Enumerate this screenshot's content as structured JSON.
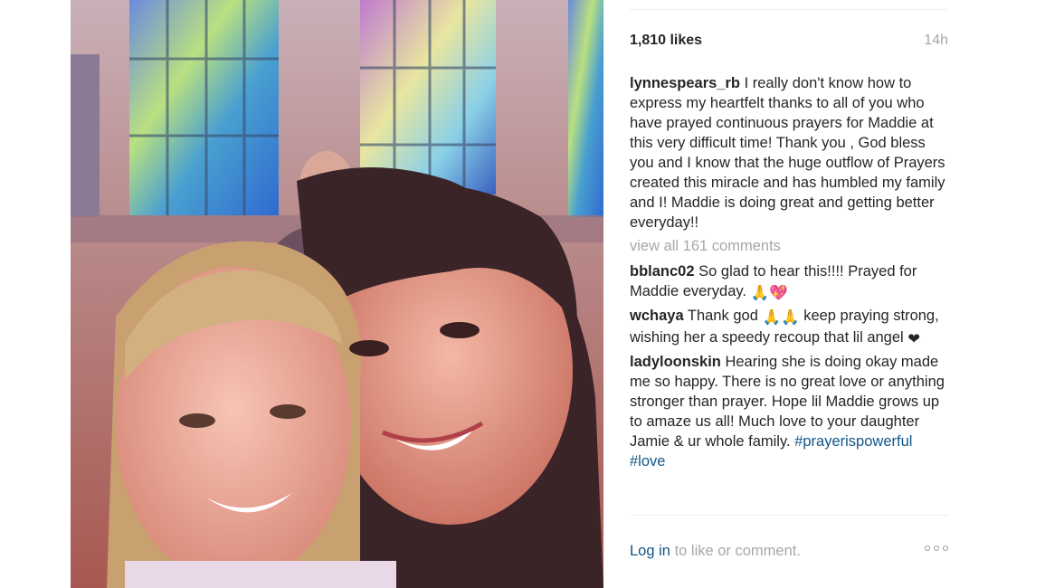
{
  "post": {
    "likes": "1,810 likes",
    "time": "14h",
    "caption": {
      "user": "lynnespears_rb",
      "text": "I really don't know how to express my heartfelt thanks to all of you who have prayed continuous prayers for Maddie at this very difficult time! Thank you , God bless you and I know that the huge outflow of Prayers created this miracle and has humbled my family and I! Maddie is doing great and getting better everyday!!"
    },
    "view_all": "view all 161 comments",
    "comments": [
      {
        "user": "bblanc02",
        "text": "So glad to hear this!!!! Prayed for Maddie everyday.",
        "emoji": "🙏💖"
      },
      {
        "user": "wchaya",
        "text_before": "Thank god",
        "emoji": "🙏🙏",
        "text_after": "keep praying strong, wishing her a speedy recoup that lil angel",
        "emoji2": "❤"
      },
      {
        "user": "ladyloonskin",
        "text": "Hearing she is doing okay made me so happy. There is no great love or anything stronger than prayer. Hope lil Maddie grows up to amaze us all! Much love to your daughter Jamie & ur whole family.",
        "hashtags": [
          "#prayerispowerful",
          "#love"
        ]
      }
    ],
    "login_link": "Log in",
    "login_rest": "to like or comment."
  },
  "icons": [
    "more-options-icon"
  ],
  "colors": {
    "link": "#125688",
    "muted": "#a5a7aa",
    "text": "#262626"
  }
}
